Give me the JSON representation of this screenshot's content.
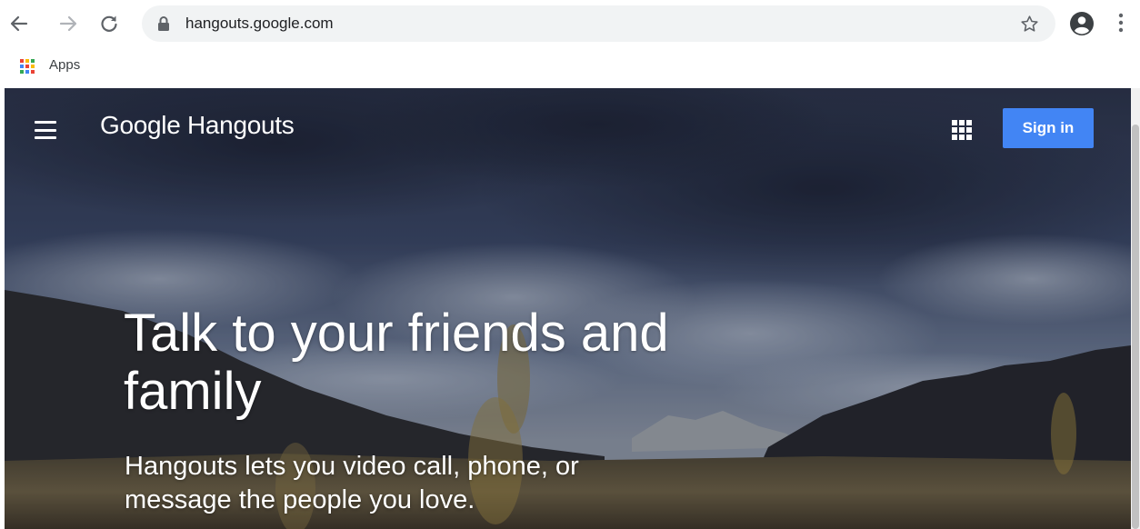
{
  "browser": {
    "url": "hangouts.google.com",
    "bookmarks": [
      {
        "label": "Apps",
        "icon": "apps-grid-icon"
      }
    ],
    "icons": [
      "back-arrow-icon",
      "forward-arrow-icon",
      "reload-icon",
      "lock-icon",
      "star-icon",
      "profile-icon",
      "kebab-menu-icon"
    ],
    "apps_colors": [
      "#ea4335",
      "#fbbc05",
      "#34a853",
      "#4285f4",
      "#ea4335",
      "#fbbc05",
      "#34a853",
      "#4285f4",
      "#ea4335"
    ]
  },
  "page": {
    "brand": {
      "google": "Google",
      "product": "Hangouts"
    },
    "sign_in_label": "Sign in",
    "headline": "Talk to your friends and family",
    "subheadline": "Hangouts lets you video call, phone, or message the people you love.",
    "colors": {
      "accent": "#4285f4",
      "text": "#ffffff"
    }
  }
}
